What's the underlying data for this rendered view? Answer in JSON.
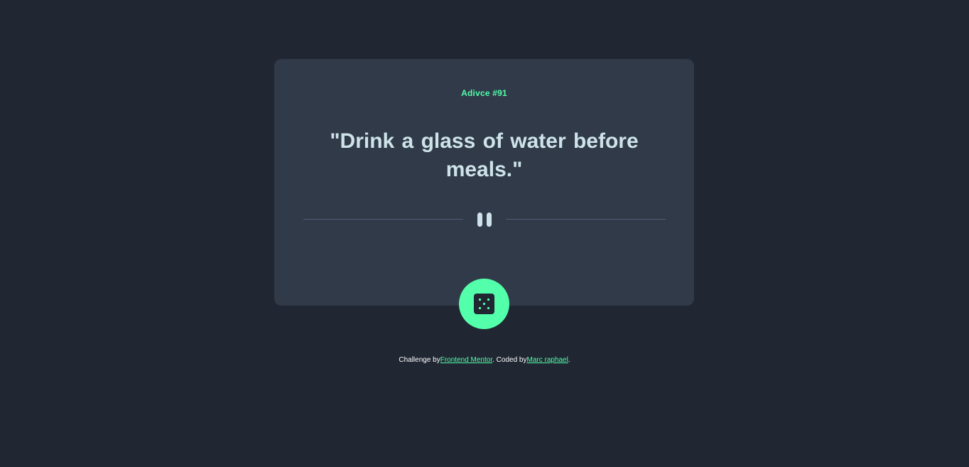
{
  "card": {
    "advice_id": "Adivce #91",
    "quote": "\"Drink a glass of water before meals.\""
  },
  "dice_button": {
    "icon": "dice-icon"
  },
  "footer": {
    "prefix": "Challenge by",
    "challenge_link": "Frontend Mentor",
    "middle": ". Coded by",
    "author_link": "Marc raphael",
    "suffix": "."
  },
  "colors": {
    "background": "#202632",
    "card": "#313A49",
    "accent": "#53FFAA",
    "quote_text": "#CEE3E9",
    "divider": "#4F5D74"
  }
}
